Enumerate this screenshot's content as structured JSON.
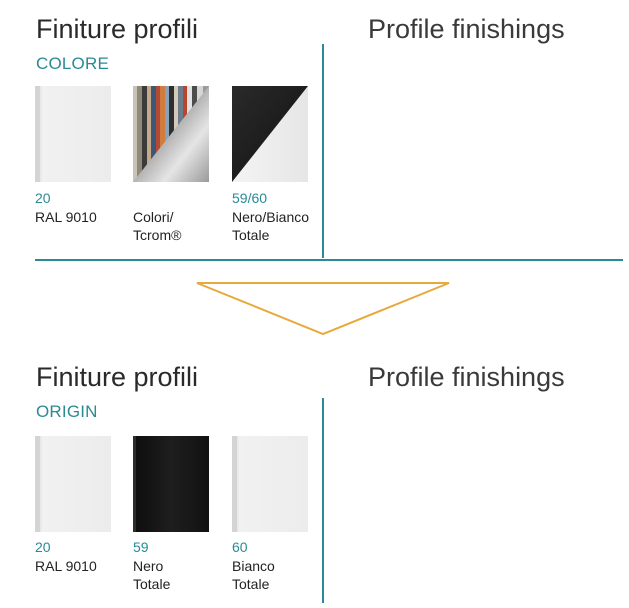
{
  "sections": [
    {
      "title": "Finiture profili",
      "title_en": "Profile finishings",
      "subtitle": "COLORE",
      "items": [
        {
          "code": "20",
          "name_lines": [
            "RAL 9010",
            ""
          ],
          "swatch": "white-icon"
        },
        {
          "code": "",
          "name_lines": [
            "Colori/",
            "Tcrom®"
          ],
          "swatch": "multicolor-chrome-icon"
        },
        {
          "code": "59/60",
          "name_lines": [
            "Nero/Bianco",
            "Totale"
          ],
          "swatch": "black-white-diagonal-icon"
        }
      ]
    },
    {
      "title": "Finiture profili",
      "title_en": "Profile finishings",
      "subtitle": "ORIGIN",
      "items": [
        {
          "code": "20",
          "name_lines": [
            "RAL 9010",
            ""
          ],
          "swatch": "white-icon"
        },
        {
          "code": "59",
          "name_lines": [
            "Nero",
            "Totale"
          ],
          "swatch": "black-icon"
        },
        {
          "code": "60",
          "name_lines": [
            "Bianco",
            "Totale"
          ],
          "swatch": "white-icon"
        }
      ]
    }
  ],
  "colors": {
    "accent": "#2a8a95",
    "arrow": "#e8a93c"
  }
}
